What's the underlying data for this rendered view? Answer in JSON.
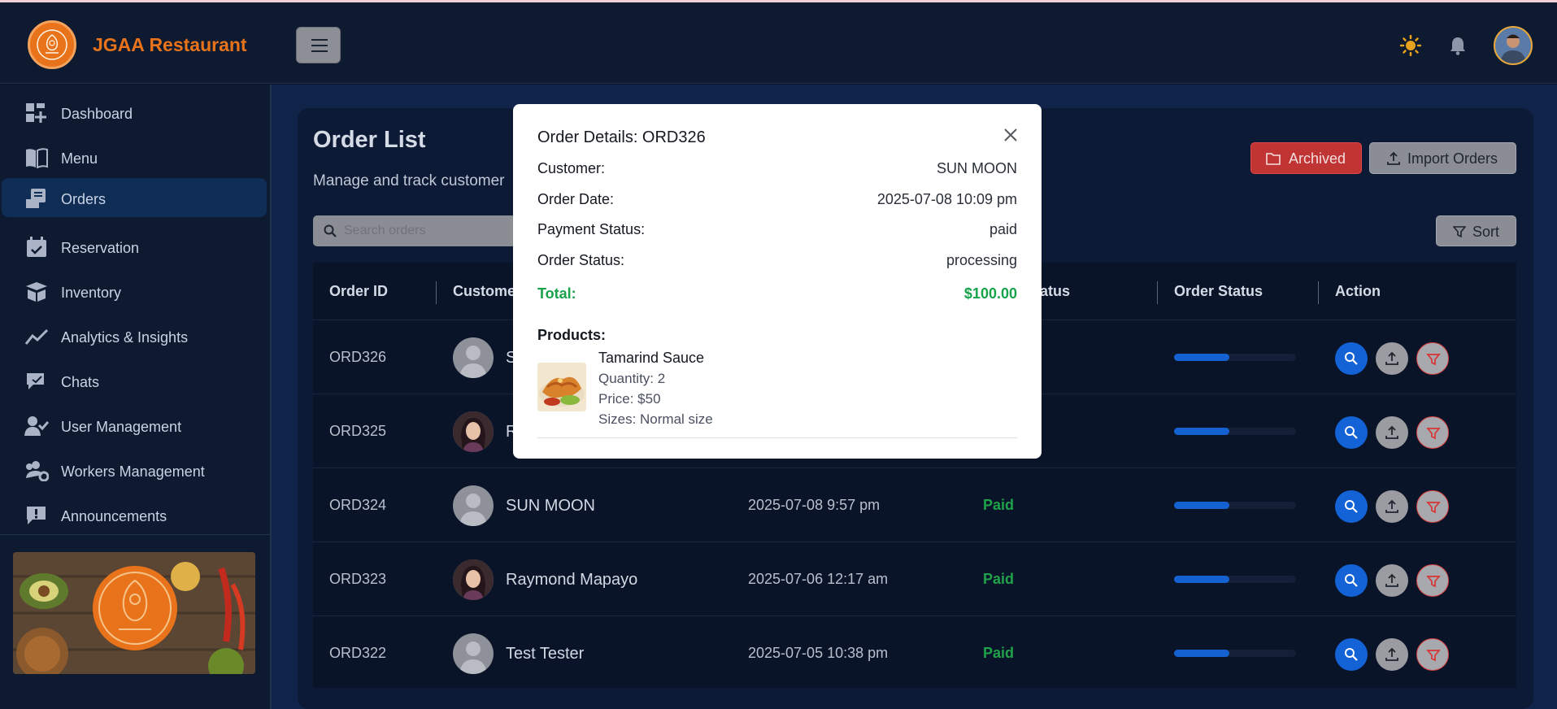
{
  "brand": {
    "name": "JGAA Restaurant"
  },
  "sidebar": {
    "items": [
      {
        "label": "Dashboard",
        "icon": "dashboard-icon"
      },
      {
        "label": "Menu",
        "icon": "book-icon"
      },
      {
        "label": "Orders",
        "icon": "orders-icon",
        "active": true
      },
      {
        "label": "Reservation",
        "icon": "calendar-check-icon"
      },
      {
        "label": "Inventory",
        "icon": "box-icon"
      },
      {
        "label": "Analytics & Insights",
        "icon": "chart-line-icon"
      },
      {
        "label": "Chats",
        "icon": "chat-icon"
      },
      {
        "label": "User Management",
        "icon": "user-check-icon"
      },
      {
        "label": "Workers Management",
        "icon": "users-gear-icon"
      },
      {
        "label": "Announcements",
        "icon": "announcement-icon"
      }
    ]
  },
  "page": {
    "title": "Order List",
    "subtitle": "Manage and track customer",
    "archived_label": "Archived",
    "import_label": "Import Orders",
    "sort_label": "Sort",
    "search_placeholder": "Search orders"
  },
  "table": {
    "headers": [
      "Order ID",
      "Custome",
      "t Status",
      "Order Status",
      "Action"
    ],
    "rows": [
      {
        "id": "ORD326",
        "name": "S",
        "date": "",
        "payment": "",
        "progress": 0.45
      },
      {
        "id": "ORD325",
        "name": "R",
        "date": "",
        "payment": "",
        "progress": 0.45
      },
      {
        "id": "ORD324",
        "name": "SUN MOON",
        "date": "2025-07-08 9:57 pm",
        "payment": "Paid",
        "progress": 0.45
      },
      {
        "id": "ORD323",
        "name": "Raymond Mapayo",
        "date": "2025-07-06 12:17 am",
        "payment": "Paid",
        "progress": 0.45
      },
      {
        "id": "ORD322",
        "name": "Test Tester",
        "date": "2025-07-05 10:38 pm",
        "payment": "Paid",
        "progress": 0.45
      }
    ]
  },
  "modal": {
    "title": "Order Details: ORD326",
    "fields": [
      {
        "key": "Customer:",
        "value": "SUN MOON"
      },
      {
        "key": "Order Date:",
        "value": "2025-07-08 10:09 pm"
      },
      {
        "key": "Payment Status:",
        "value": "paid"
      },
      {
        "key": "Order Status:",
        "value": "processing"
      }
    ],
    "total_label": "Total:",
    "total_value": "$100.00",
    "products_label": "Products:",
    "product": {
      "name": "Tamarind Sauce",
      "quantity": "Quantity: 2",
      "price": "Price: $50",
      "sizes": "Sizes: Normal size"
    }
  },
  "colors": {
    "accent": "#e8731a",
    "active_nav": "#0f2d55",
    "paid_green": "#1fa24a",
    "primary_blue": "#1362d6",
    "danger_red": "#c03434"
  }
}
